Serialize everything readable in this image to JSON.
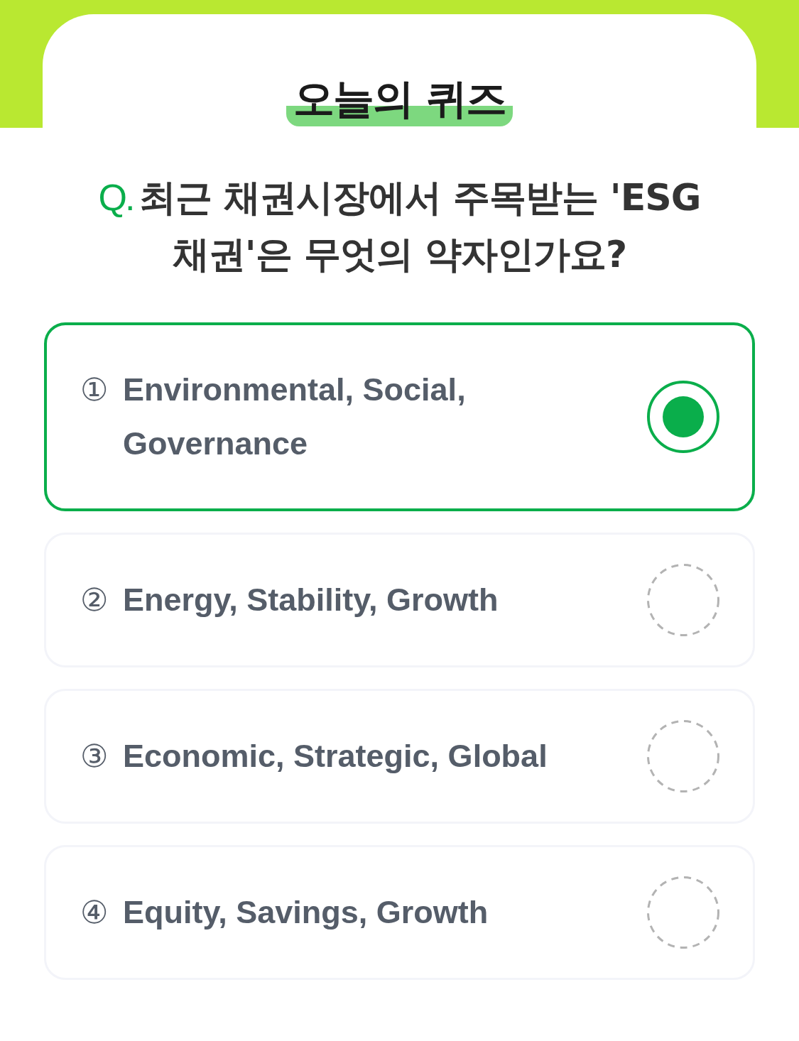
{
  "header": {
    "title": "오늘의 퀴즈"
  },
  "question": {
    "prefix": "Q.",
    "text": "최근 채권시장에서 주목받는 'ESG 채권'은 무엇의 약자인가요?"
  },
  "options": [
    {
      "number": "①",
      "label": "Environmental, Social, Governance",
      "selected": true
    },
    {
      "number": "②",
      "label": "Energy, Stability, Growth",
      "selected": false
    },
    {
      "number": "③",
      "label": "Economic, Strategic, Global",
      "selected": false
    },
    {
      "number": "④",
      "label": "Equity, Savings, Growth",
      "selected": false
    }
  ]
}
